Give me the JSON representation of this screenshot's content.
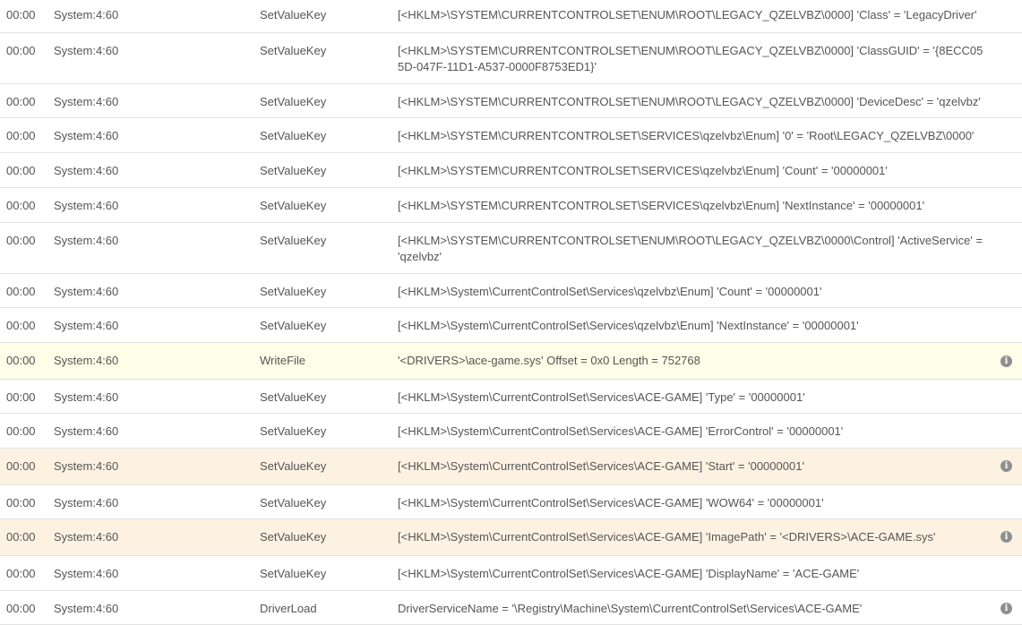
{
  "rows": [
    {
      "time": "00:00",
      "process": "System:4:60",
      "operation": "SetValueKey",
      "detail": "[<HKLM>\\SYSTEM\\CURRENTCONTROLSET\\ENUM\\ROOT\\LEGACY_QZELVBZ\\0000] 'Class' = 'LegacyDriver'",
      "highlight": "none",
      "info_icon": false
    },
    {
      "time": "00:00",
      "process": "System:4:60",
      "operation": "SetValueKey",
      "detail": "[<HKLM>\\SYSTEM\\CURRENTCONTROLSET\\ENUM\\ROOT\\LEGACY_QZELVBZ\\0000] 'ClassGUID' = '{8ECC055D-047F-11D1-A537-0000F8753ED1}'",
      "highlight": "none",
      "info_icon": false
    },
    {
      "time": "00:00",
      "process": "System:4:60",
      "operation": "SetValueKey",
      "detail": "[<HKLM>\\SYSTEM\\CURRENTCONTROLSET\\ENUM\\ROOT\\LEGACY_QZELVBZ\\0000] 'DeviceDesc' = 'qzelvbz'",
      "highlight": "none",
      "info_icon": false
    },
    {
      "time": "00:00",
      "process": "System:4:60",
      "operation": "SetValueKey",
      "detail": "[<HKLM>\\SYSTEM\\CURRENTCONTROLSET\\SERVICES\\qzelvbz\\Enum] '0' = 'Root\\LEGACY_QZELVBZ\\0000'",
      "highlight": "none",
      "info_icon": false
    },
    {
      "time": "00:00",
      "process": "System:4:60",
      "operation": "SetValueKey",
      "detail": "[<HKLM>\\SYSTEM\\CURRENTCONTROLSET\\SERVICES\\qzelvbz\\Enum] 'Count' = '00000001'",
      "highlight": "none",
      "info_icon": false
    },
    {
      "time": "00:00",
      "process": "System:4:60",
      "operation": "SetValueKey",
      "detail": "[<HKLM>\\SYSTEM\\CURRENTCONTROLSET\\SERVICES\\qzelvbz\\Enum] 'NextInstance' = '00000001'",
      "highlight": "none",
      "info_icon": false
    },
    {
      "time": "00:00",
      "process": "System:4:60",
      "operation": "SetValueKey",
      "detail": "[<HKLM>\\SYSTEM\\CURRENTCONTROLSET\\ENUM\\ROOT\\LEGACY_QZELVBZ\\0000\\Control] 'ActiveService' = 'qzelvbz'",
      "highlight": "none",
      "info_icon": false
    },
    {
      "time": "00:00",
      "process": "System:4:60",
      "operation": "SetValueKey",
      "detail": "[<HKLM>\\System\\CurrentControlSet\\Services\\qzelvbz\\Enum] 'Count' = '00000001'",
      "highlight": "none",
      "info_icon": false
    },
    {
      "time": "00:00",
      "process": "System:4:60",
      "operation": "SetValueKey",
      "detail": "[<HKLM>\\System\\CurrentControlSet\\Services\\qzelvbz\\Enum] 'NextInstance' = '00000001'",
      "highlight": "none",
      "info_icon": false
    },
    {
      "time": "00:00",
      "process": "System:4:60",
      "operation": "WriteFile",
      "detail": "'<DRIVERS>\\ace-game.sys' Offset = 0x0 Length = 752768",
      "highlight": "yellow",
      "info_icon": true
    },
    {
      "time": "00:00",
      "process": "System:4:60",
      "operation": "SetValueKey",
      "detail": "[<HKLM>\\System\\CurrentControlSet\\Services\\ACE-GAME] 'Type' = '00000001'",
      "highlight": "none",
      "info_icon": false
    },
    {
      "time": "00:00",
      "process": "System:4:60",
      "operation": "SetValueKey",
      "detail": "[<HKLM>\\System\\CurrentControlSet\\Services\\ACE-GAME] 'ErrorControl' = '00000001'",
      "highlight": "none",
      "info_icon": false
    },
    {
      "time": "00:00",
      "process": "System:4:60",
      "operation": "SetValueKey",
      "detail": "[<HKLM>\\System\\CurrentControlSet\\Services\\ACE-GAME] 'Start' = '00000001'",
      "highlight": "orange",
      "info_icon": true
    },
    {
      "time": "00:00",
      "process": "System:4:60",
      "operation": "SetValueKey",
      "detail": "[<HKLM>\\System\\CurrentControlSet\\Services\\ACE-GAME] 'WOW64' = '00000001'",
      "highlight": "none",
      "info_icon": false
    },
    {
      "time": "00:00",
      "process": "System:4:60",
      "operation": "SetValueKey",
      "detail": "[<HKLM>\\System\\CurrentControlSet\\Services\\ACE-GAME] 'ImagePath' = '<DRIVERS>\\ACE-GAME.sys'",
      "highlight": "orange",
      "info_icon": true
    },
    {
      "time": "00:00",
      "process": "System:4:60",
      "operation": "SetValueKey",
      "detail": "[<HKLM>\\System\\CurrentControlSet\\Services\\ACE-GAME] 'DisplayName' = 'ACE-GAME'",
      "highlight": "none",
      "info_icon": false
    },
    {
      "time": "00:00",
      "process": "System:4:60",
      "operation": "DriverLoad",
      "detail": "DriverServiceName = '\\Registry\\Machine\\System\\CurrentControlSet\\Services\\ACE-GAME'",
      "highlight": "none",
      "info_icon": true
    }
  ],
  "colors": {
    "highlight_yellow": "#fefde8",
    "highlight_orange": "#fdf2e2",
    "row_border": "#e3e3e3",
    "text": "#555555",
    "info_icon": "#8f8f8f"
  },
  "icons": {
    "info": "info-circle-icon"
  },
  "info_glyph": "i"
}
